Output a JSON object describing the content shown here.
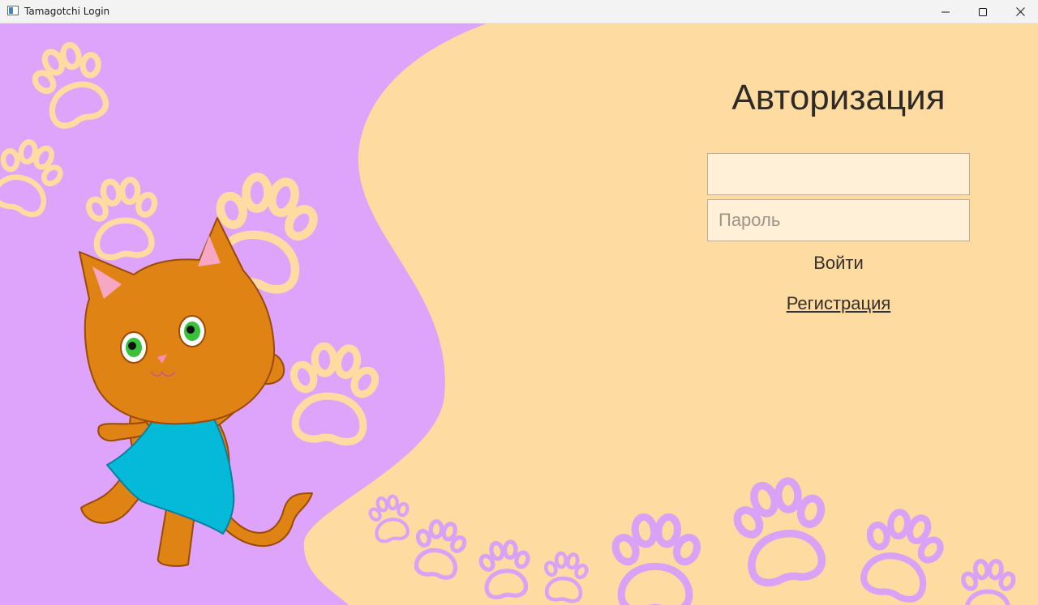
{
  "window": {
    "title": "Tamagotchi Login",
    "controls": [
      "minimize",
      "maximize",
      "close"
    ]
  },
  "colors": {
    "background_peach": "#fedba0",
    "background_purple": "#dea3fb",
    "paw_outline_light": "#fedba0",
    "paw_outline_purple": "#d9a2f6",
    "cat_fur": "#e08315",
    "dress": "#05bad9"
  },
  "login_form": {
    "heading": "Авторизация",
    "login_field": {
      "value": "",
      "placeholder": ""
    },
    "password_field": {
      "value": "",
      "placeholder": "Пароль"
    },
    "login_button": "Войти",
    "register_link": "Регистрация"
  },
  "illustration": {
    "icons": [
      "cat-illustration",
      "paw-print-icon"
    ]
  }
}
